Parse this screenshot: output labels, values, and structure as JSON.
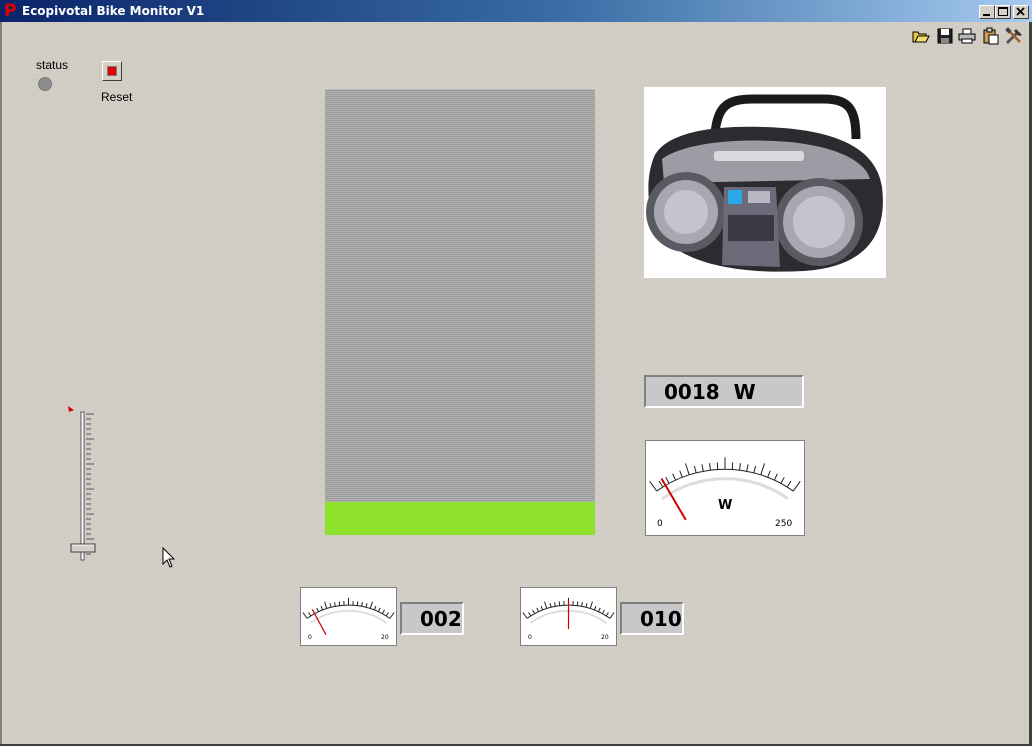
{
  "window": {
    "title": "Ecopivotal Bike Monitor V1",
    "app_icon": "P",
    "minimize_icon": "minimize-icon",
    "maximize_icon": "maximize-icon",
    "close_icon": "close-icon"
  },
  "toolbar": {
    "icons": [
      "open-folder-icon",
      "save-icon",
      "print-icon",
      "clipboard-icon",
      "tools-icon"
    ]
  },
  "status": {
    "label": "status",
    "led_color": "#8c8c8c"
  },
  "reset": {
    "label": "Reset"
  },
  "tank": {
    "fill_fraction": 0.075,
    "fill_color": "#8ee22b"
  },
  "power": {
    "readout": "0018  W",
    "meter": {
      "unit": "W",
      "min_label": "0",
      "max_label": "250",
      "min": 0,
      "max": 250,
      "value": 18
    }
  },
  "small_meter_1": {
    "readout": "002",
    "min_label": "0",
    "max_label": "20",
    "min": 0,
    "max": 20,
    "value": 2
  },
  "small_meter_2": {
    "readout": "010",
    "min_label": "0",
    "max_label": "20",
    "min": 0,
    "max": 20,
    "value": 10
  },
  "slider": {
    "value_fraction": 0.0
  }
}
